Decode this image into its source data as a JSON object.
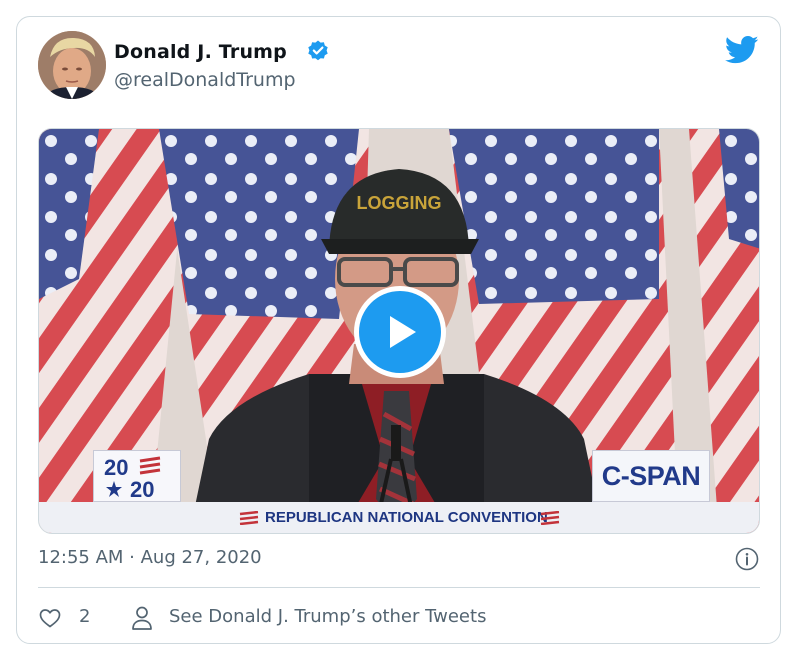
{
  "author": {
    "display_name": "Donald J. Trump",
    "handle": "@realDonaldTrump",
    "verified": true,
    "avatar": "profile-photo"
  },
  "brand": {
    "icon": "twitter-bird-icon",
    "color": "#1d9bf0"
  },
  "media": {
    "type": "video",
    "play_icon": "play-icon",
    "broadcast_logo_year_top": "20",
    "broadcast_logo_year_bottom": "20",
    "network_logo": "C-SPAN",
    "lower_third": "REPUBLICAN NATIONAL CONVENTION",
    "hat_text": "LOGGING"
  },
  "meta": {
    "timestamp": "12:55 AM · Aug 27, 2020",
    "info_icon": "info-icon"
  },
  "actions": {
    "like_count": "2",
    "other_tweets_label": "See Donald J. Trump’s other Tweets"
  },
  "colors": {
    "text_primary": "#0f1419",
    "text_secondary": "#536471",
    "border": "#cfd9de",
    "accent": "#1d9bf0",
    "cspan_blue": "#213a8a",
    "flag_red": "#c3333a"
  }
}
